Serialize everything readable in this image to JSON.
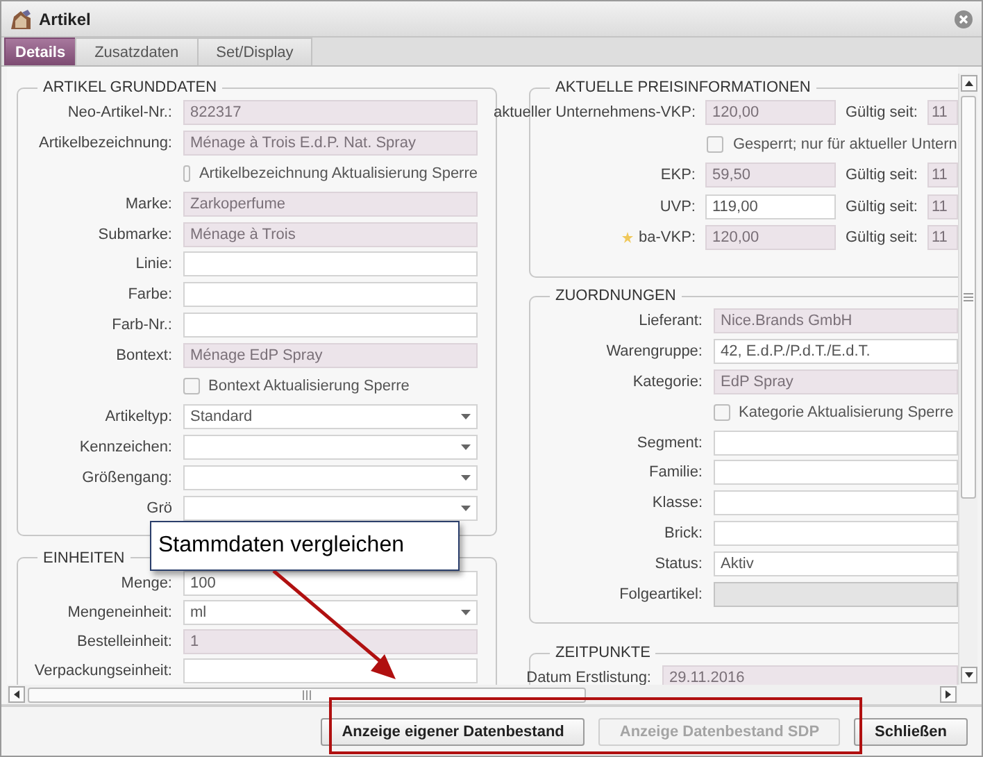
{
  "window": {
    "title": "Artikel"
  },
  "tabs": [
    {
      "label": "Details",
      "selected": true
    },
    {
      "label": "Zusatzdaten",
      "selected": false
    },
    {
      "label": "Set/Display",
      "selected": false
    }
  ],
  "left_column": [
    {
      "title": "ARTIKEL GRUNDDATEN",
      "rows": [
        {
          "kind": "text",
          "label": "Neo-Artikel-Nr.:",
          "value": "822317",
          "readonly": true,
          "disabled": false
        },
        {
          "kind": "text",
          "label": "Artikelbezeichnung:",
          "value": "Ménage à Trois E.d.P. Nat. Spray",
          "readonly": true,
          "disabled": false
        },
        {
          "kind": "checkbox",
          "label": "Artikelbezeichnung Aktualisierung Sperre",
          "checked": false
        },
        {
          "kind": "text",
          "label": "Marke:",
          "value": "Zarkoperfume",
          "readonly": true,
          "disabled": false
        },
        {
          "kind": "text",
          "label": "Submarke:",
          "value": "Ménage à Trois",
          "readonly": true,
          "disabled": false
        },
        {
          "kind": "text",
          "label": "Linie:",
          "value": "",
          "readonly": false,
          "disabled": false
        },
        {
          "kind": "text",
          "label": "Farbe:",
          "value": "",
          "readonly": false,
          "disabled": false
        },
        {
          "kind": "text",
          "label": "Farb-Nr.:",
          "value": "",
          "readonly": false,
          "disabled": false
        },
        {
          "kind": "text",
          "label": "Bontext:",
          "value": "Ménage EdP Spray",
          "readonly": true,
          "disabled": false
        },
        {
          "kind": "checkbox",
          "label": "Bontext Aktualisierung Sperre",
          "checked": false
        },
        {
          "kind": "select",
          "label": "Artikeltyp:",
          "value": "Standard"
        },
        {
          "kind": "select",
          "label": "Kennzeichen:",
          "value": ""
        },
        {
          "kind": "select",
          "label": "Größengang:",
          "value": ""
        },
        {
          "kind": "select",
          "label": "Grö",
          "value": ""
        }
      ]
    },
    {
      "title": "EINHEITEN",
      "rows": [
        {
          "kind": "text",
          "label": "Menge:",
          "value": "100",
          "readonly": false,
          "disabled": false
        },
        {
          "kind": "select",
          "label": "Mengeneinheit:",
          "value": "ml"
        },
        {
          "kind": "text",
          "label": "Bestelleinheit:",
          "value": "1",
          "readonly": true,
          "disabled": false
        },
        {
          "kind": "text",
          "label": "Verpackungseinheit:",
          "value": "",
          "readonly": false,
          "disabled": false
        }
      ]
    }
  ],
  "right_column": [
    {
      "title": "AKTUELLE PREISINFORMATIONEN",
      "rows": [
        {
          "kind": "price",
          "label": "aktueller Unternehmens-VKP:",
          "value": "120,00",
          "readonly": true,
          "disabled": false,
          "since_label": "Gültig seit:",
          "since_value": "11"
        },
        {
          "kind": "checkbox",
          "label": "Gesperrt; nur für aktueller Untern",
          "checked": false
        },
        {
          "kind": "price",
          "label": "EKP:",
          "value": "59,50",
          "readonly": true,
          "disabled": false,
          "since_label": "Gültig seit:",
          "since_value": "11"
        },
        {
          "kind": "price",
          "label": "UVP:",
          "value": "119,00",
          "readonly": false,
          "disabled": false,
          "since_label": "Gültig seit:",
          "since_value": "11"
        },
        {
          "kind": "price",
          "label": "ba-VKP:",
          "value": "120,00",
          "readonly": true,
          "disabled": false,
          "starred": true,
          "since_label": "Gültig seit:",
          "since_value": "11"
        }
      ]
    },
    {
      "title": "ZUORDNUNGEN",
      "rows": [
        {
          "kind": "text",
          "label": "Lieferant:",
          "value": "Nice.Brands GmbH",
          "readonly": true,
          "disabled": false
        },
        {
          "kind": "text",
          "label": "Warengruppe:",
          "value": "42, E.d.P./P.d.T./E.d.T.",
          "readonly": false,
          "disabled": false
        },
        {
          "kind": "text",
          "label": "Kategorie:",
          "value": "EdP Spray",
          "readonly": true,
          "disabled": false
        },
        {
          "kind": "checkbox",
          "label": "Kategorie Aktualisierung Sperre",
          "checked": false
        },
        {
          "kind": "text",
          "label": "Segment:",
          "value": "",
          "readonly": false,
          "disabled": false
        },
        {
          "kind": "text",
          "label": "Familie:",
          "value": "",
          "readonly": false,
          "disabled": false
        },
        {
          "kind": "text",
          "label": "Klasse:",
          "value": "",
          "readonly": false,
          "disabled": false
        },
        {
          "kind": "text",
          "label": "Brick:",
          "value": "",
          "readonly": false,
          "disabled": false
        },
        {
          "kind": "text",
          "label": "Status:",
          "value": "Aktiv",
          "readonly": false,
          "disabled": false
        },
        {
          "kind": "text",
          "label": "Folgeartikel:",
          "value": "",
          "readonly": false,
          "disabled": true
        }
      ]
    },
    {
      "title": "ZEITPUNKTE",
      "rows": [
        {
          "kind": "text",
          "label": "Datum Erstlistung:",
          "value": "29.11.2016",
          "readonly": true,
          "disabled": false
        }
      ]
    }
  ],
  "buttons": [
    {
      "label": "Anzeige eigener Datenbestand",
      "disabled": false
    },
    {
      "label": "Anzeige Datenbestand SDP",
      "disabled": true
    },
    {
      "label": "Schließen",
      "disabled": false
    }
  ],
  "callout": {
    "text": "Stammdaten vergleichen"
  }
}
